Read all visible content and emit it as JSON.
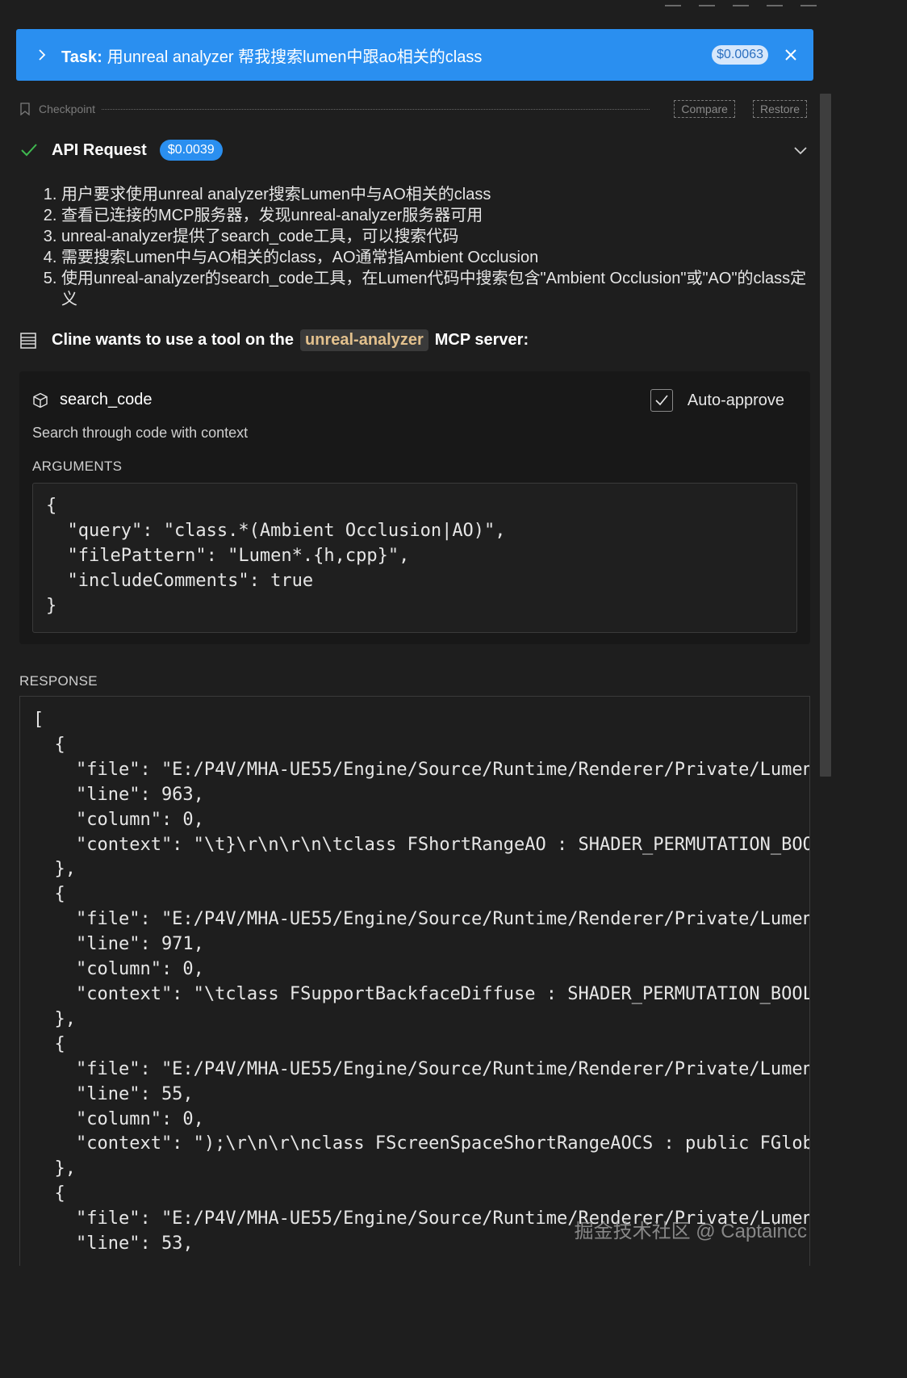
{
  "task": {
    "label": "Task:",
    "text": "用unreal analyzer 帮我搜索lumen中跟ao相关的class",
    "cost": "$0.0063"
  },
  "checkpoint": {
    "label": "Checkpoint",
    "compare": "Compare",
    "restore": "Restore"
  },
  "api_request": {
    "label": "API Request",
    "cost": "$0.0039"
  },
  "steps": [
    "用户要求使用unreal analyzer搜索Lumen中与AO相关的class",
    "查看已连接的MCP服务器，发现unreal-analyzer服务器可用",
    "unreal-analyzer提供了search_code工具，可以搜索代码",
    "需要搜索Lumen中与AO相关的class，AO通常指Ambient Occlusion",
    "使用unreal-analyzer的search_code工具，在Lumen代码中搜索包含\"Ambient Occlusion\"或\"AO\"的class定义"
  ],
  "tool_line": {
    "prefix": "Cline wants to use a tool on the",
    "server": "unreal-analyzer",
    "suffix": "MCP server:"
  },
  "tool": {
    "name": "search_code",
    "description": "Search through code with context",
    "auto_approve": "Auto-approve",
    "arguments_label": "ARGUMENTS",
    "arguments": "{\n  \"query\": \"class.*(Ambient Occlusion|AO)\",\n  \"filePattern\": \"Lumen*.{h,cpp}\",\n  \"includeComments\": true\n}"
  },
  "response": {
    "label": "RESPONSE",
    "body": "[\n  {\n    \"file\": \"E:/P4V/MHA-UE55/Engine/Source/Runtime/Renderer/Private/Lumen\n    \"line\": 963,\n    \"column\": 0,\n    \"context\": \"\\t}\\r\\n\\r\\n\\tclass FShortRangeAO : SHADER_PERMUTATION_BOOL\n  },\n  {\n    \"file\": \"E:/P4V/MHA-UE55/Engine/Source/Runtime/Renderer/Private/Lumen\n    \"line\": 971,\n    \"column\": 0,\n    \"context\": \"\\tclass FSupportBackfaceDiffuse : SHADER_PERMUTATION_BOOL\n  },\n  {\n    \"file\": \"E:/P4V/MHA-UE55/Engine/Source/Runtime/Renderer/Private/Lumen\n    \"line\": 55,\n    \"column\": 0,\n    \"context\": \");\\r\\n\\r\\nclass FScreenSpaceShortRangeAOCS : public FGlobal\n  },\n  {\n    \"file\": \"E:/P4V/MHA-UE55/Engine/Source/Runtime/Renderer/Private/Lumen\n    \"line\": 53,"
  },
  "watermark": "掘金技术社区 @ Captaincc",
  "colors": {
    "background": "#1e1e1e",
    "task_bar": "#2a8ff0",
    "check_green": "#3fb950",
    "server_pill_text": "#e2c08d"
  },
  "icons": [
    "chevron-right-icon",
    "close-icon",
    "bookmark-icon",
    "check-icon",
    "chevron-down-icon",
    "server-icon",
    "cube-icon",
    "checkbox-checked-icon"
  ]
}
